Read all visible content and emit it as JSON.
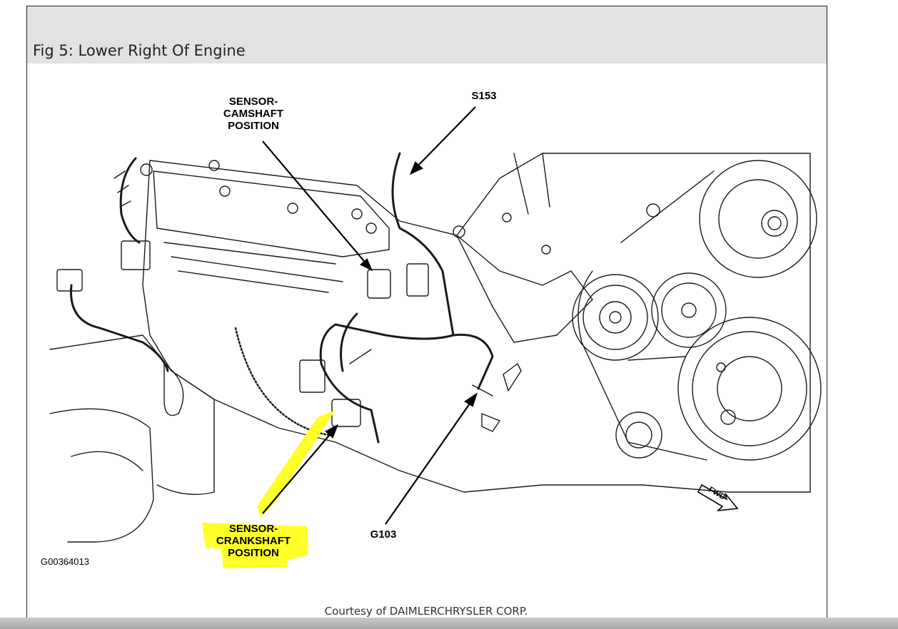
{
  "figure": {
    "title": "Fig 5: Lower Right Of Engine",
    "figure_id": "G00364013",
    "courtesy": "Courtesy of DAIMLERCHRYSLER CORP."
  },
  "callouts": {
    "camshaft": [
      "SENSOR-",
      "CAMSHAFT",
      "POSITION"
    ],
    "crankshaft": [
      "SENSOR-",
      "CRANKSHAFT",
      "POSITION"
    ],
    "s153": "S153",
    "g103": "G103",
    "fwd": "FWD"
  },
  "colors": {
    "highlight": "#ffff1e",
    "line_art": "#1a1a1a",
    "title_bar": "#e2e2e2"
  }
}
